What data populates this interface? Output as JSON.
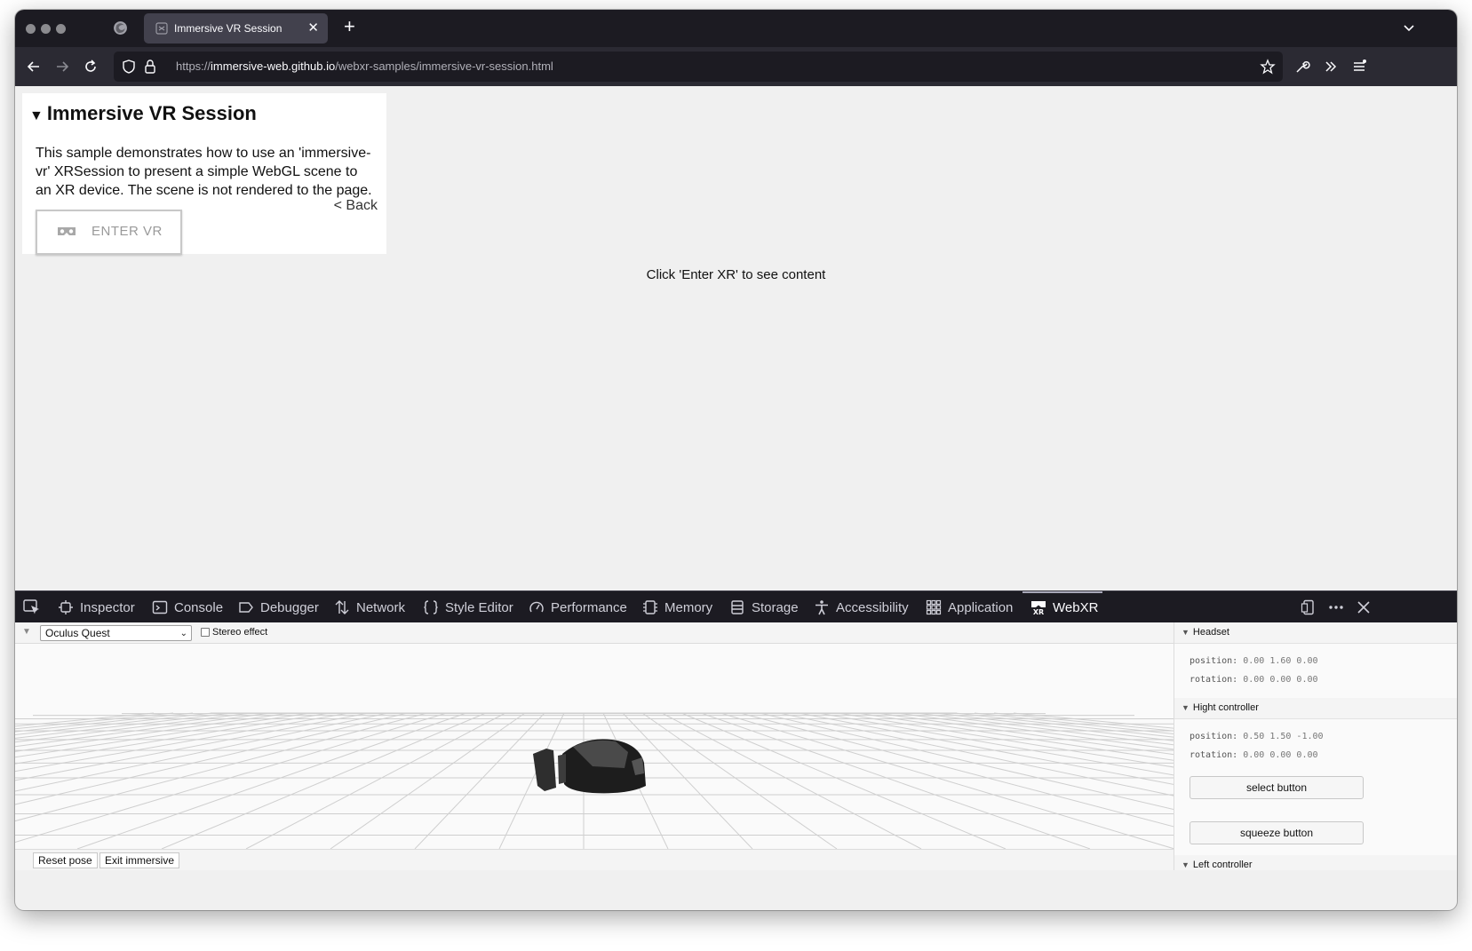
{
  "browser": {
    "tab_title": "Immersive VR Session",
    "url_prefix": "https://",
    "url_host": "immersive-web.github.io",
    "url_path": "/webxr-samples/immersive-vr-session.html"
  },
  "page": {
    "title": "Immersive VR Session",
    "description": "This sample demonstrates how to use an 'immersive-vr' XRSession to present a simple WebGL scene to an XR device. The scene is not rendered to the page.",
    "back_link": "< Back",
    "enter_vr_label": "ENTER VR",
    "center_message": "Click 'Enter XR' to see content"
  },
  "devtools": {
    "tabs": [
      {
        "label": "Inspector",
        "icon": "inspector-icon"
      },
      {
        "label": "Console",
        "icon": "console-icon"
      },
      {
        "label": "Debugger",
        "icon": "debugger-icon"
      },
      {
        "label": "Network",
        "icon": "network-icon"
      },
      {
        "label": "Style Editor",
        "icon": "style-editor-icon"
      },
      {
        "label": "Performance",
        "icon": "performance-icon"
      },
      {
        "label": "Memory",
        "icon": "memory-icon"
      },
      {
        "label": "Storage",
        "icon": "storage-icon"
      },
      {
        "label": "Accessibility",
        "icon": "accessibility-icon"
      },
      {
        "label": "Application",
        "icon": "application-icon"
      },
      {
        "label": "WebXR",
        "icon": "webxr-icon",
        "selected": true
      }
    ]
  },
  "webxr": {
    "device": "Oculus Quest",
    "stereo_label": "Stereo effect",
    "stereo_checked": false,
    "reset_pose": "Reset pose",
    "exit_immersive": "Exit immersive",
    "headset": {
      "title": "Headset",
      "position_label": "position:",
      "position": "0.00 1.60 0.00",
      "rotation_label": "rotation:",
      "rotation": "0.00 0.00 0.00"
    },
    "right_controller": {
      "title": "Hight controller",
      "position_label": "position:",
      "position": "0.50 1.50 -1.00",
      "rotation_label": "rotation:",
      "rotation": "0.00 0.00 0.00",
      "select_button": "select button",
      "squeeze_button": "squeeze button"
    },
    "left_controller": {
      "title": "Left controller"
    }
  },
  "colors": {
    "chrome_dark": "#1c1b22",
    "navbar": "#2b2a33",
    "tab_active": "#42414d",
    "page_bg": "#f0f0f0"
  }
}
